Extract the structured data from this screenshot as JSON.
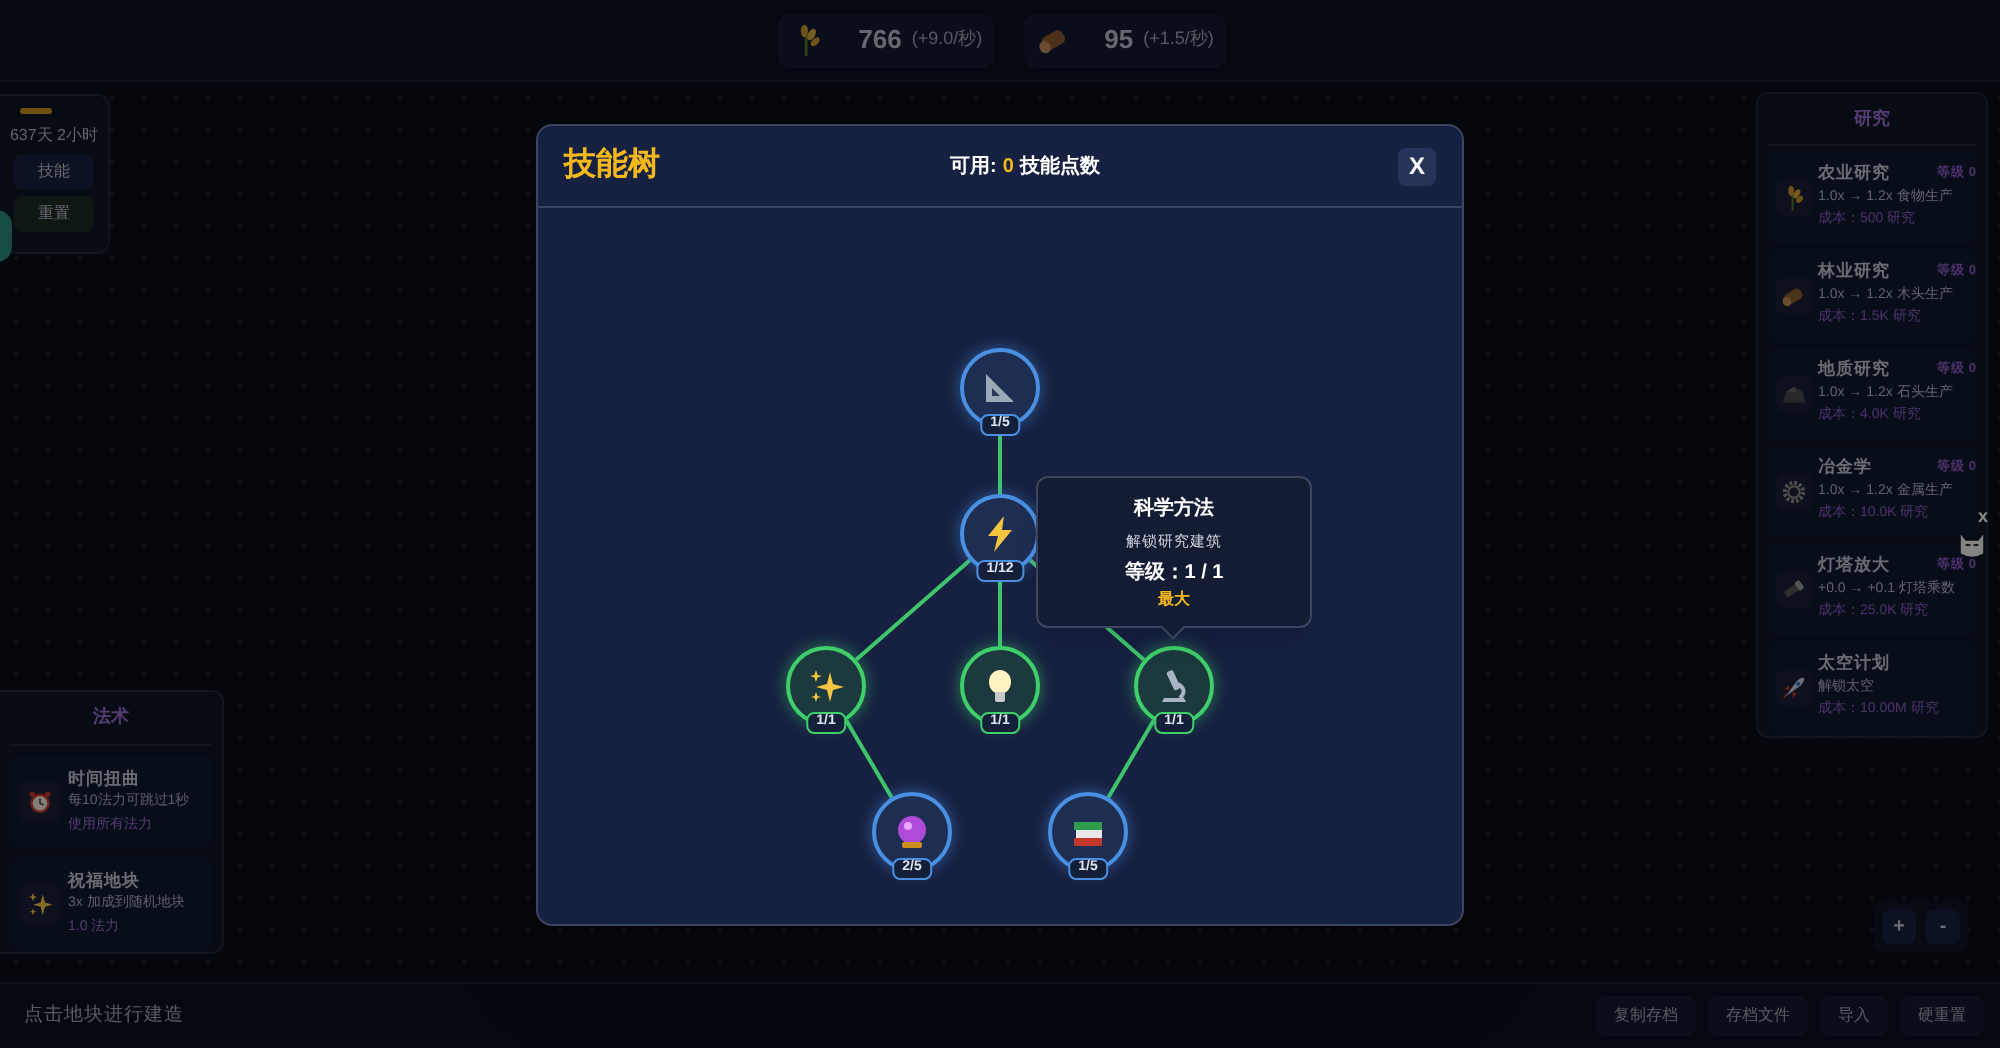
{
  "resources": [
    {
      "amount": "766",
      "rate": "(+9.0/秒)"
    },
    {
      "amount": "95",
      "rate": "(+1.5/秒)"
    }
  ],
  "time_panel": {
    "time": "637天 2小时",
    "buttons": [
      {
        "label": "技能",
        "kind": "plain"
      },
      {
        "label": "重置",
        "kind": "reset"
      }
    ]
  },
  "spells": {
    "title": "法术",
    "items": [
      {
        "name": "时间扭曲",
        "description": "每10法力可跳过1秒",
        "cost": "使用所有法力"
      },
      {
        "name": "祝福地块",
        "description": "3x 加成到随机地块",
        "cost": "1.0 法力"
      }
    ]
  },
  "research": {
    "title": "研究",
    "items": [
      {
        "name": "农业研究",
        "rank": "等级 0",
        "effect": "1.0x → 1.2x 食物生产",
        "cost": "成本：500 研究"
      },
      {
        "name": "林业研究",
        "rank": "等级 0",
        "effect": "1.0x → 1.2x 木头生产",
        "cost": "成本：1.5K 研究"
      },
      {
        "name": "地质研究",
        "rank": "等级 0",
        "effect": "1.0x → 1.2x 石头生产",
        "cost": "成本：4.0K 研究"
      },
      {
        "name": "冶金学",
        "rank": "等级 0",
        "effect": "1.0x → 1.2x 金属生产",
        "cost": "成本：10.0K 研究"
      },
      {
        "name": "灯塔放大",
        "rank": "等级 0",
        "effect": "+0.0 → +0.1 灯塔乘数",
        "cost": "成本：25.0K 研究"
      },
      {
        "name": "太空计划",
        "effect": "解锁太空",
        "cost": "成本：10.00M 研究"
      }
    ]
  },
  "skill_tree": {
    "title": "技能树",
    "available_label": "可用:",
    "available_points": "0",
    "points_label": "技能点数",
    "close": "X",
    "nodes": [
      {
        "progress": "1/5",
        "maxed": false,
        "children": [
          {
            "progress": "1/12",
            "maxed": false,
            "children": [
              {
                "progress": "1/1",
                "maxed": true,
                "children": [
                  {
                    "progress": "2/5",
                    "maxed": false
                  }
                ]
              },
              {
                "progress": "1/1",
                "maxed": true
              },
              {
                "progress": "1/1",
                "maxed": true,
                "tooltip": {
                  "title": "科学方法",
                  "description": "解锁研究建筑",
                  "rank": "等级：1 / 1",
                  "status": "最大"
                },
                "children": [
                  {
                    "progress": "1/5",
                    "maxed": false
                  }
                ]
              }
            ]
          }
        ]
      }
    ]
  },
  "mascot": {
    "close": "x"
  },
  "zoom_controls": [
    "+",
    "-"
  ],
  "status_bar": {
    "hint": "点击地块进行建造",
    "buttons": [
      "复制存档",
      "存档文件",
      "导入",
      "硬重置"
    ]
  }
}
